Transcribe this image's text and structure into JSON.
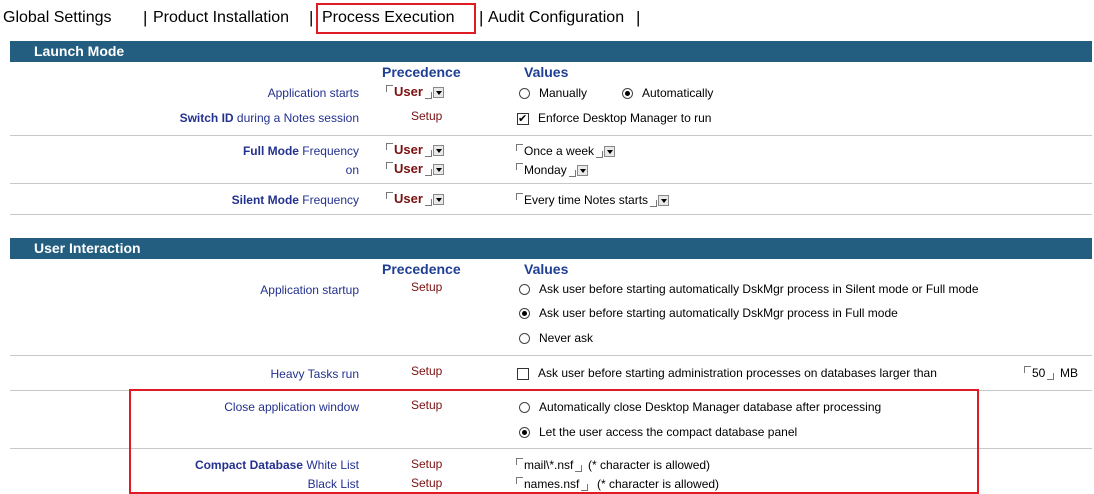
{
  "tabs": {
    "global": "Global Settings",
    "product": "Product Installation",
    "process": "Process Execution",
    "audit": "Audit Configuration"
  },
  "launch": {
    "title": "Launch Mode",
    "precedence_header": "Precedence",
    "values_header": "Values",
    "app_starts_label": "Application starts",
    "app_starts_prec": "User",
    "opt_manually": "Manually",
    "opt_automatically": "Automatically",
    "switch_id_bold": "Switch ID",
    "switch_id_rest": " during a Notes session",
    "switch_id_prec": "Setup",
    "enforce_label": "Enforce Desktop Manager to run",
    "full_mode_bold": "Full Mode",
    "full_mode_rest": " Frequency",
    "full_mode_prec": "User",
    "full_mode_value": "Once a week",
    "on_label": "on",
    "on_prec": "User",
    "on_value": "Monday",
    "silent_bold": "Silent Mode",
    "silent_rest": " Frequency",
    "silent_prec": "User",
    "silent_value": "Every time Notes starts"
  },
  "interaction": {
    "title": "User Interaction",
    "precedence_header": "Precedence",
    "values_header": "Values",
    "startup_label": "Application startup",
    "startup_prec": "Setup",
    "startup_opt1": "Ask user before starting automatically DskMgr process in Silent mode or Full mode",
    "startup_opt2": "Ask user before starting automatically DskMgr process in Full mode",
    "startup_opt3": "Never ask",
    "heavy_label": "Heavy Tasks run",
    "heavy_prec": "Setup",
    "heavy_text": "Ask user before starting administration processes on databases larger than",
    "heavy_size": "50",
    "heavy_unit": "MB",
    "close_label": "Close application window",
    "close_prec": "Setup",
    "close_opt1": "Automatically close Desktop Manager database after processing",
    "close_opt2": "Let the user access the compact database panel",
    "compact_bold": "Compact Database",
    "compact_rest": " White List",
    "white_prec": "Setup",
    "white_value": "mail\\*.nsf",
    "white_note": "(* character is allowed)",
    "black_label": "Black List",
    "black_prec": "Setup",
    "black_value": "names.nsf",
    "black_note": "(* character is allowed)"
  },
  "colors": {
    "section_bar": "#235d80",
    "highlight": "#e01b24",
    "label_text": "#23318f",
    "precedence_user": "#7a1010"
  }
}
